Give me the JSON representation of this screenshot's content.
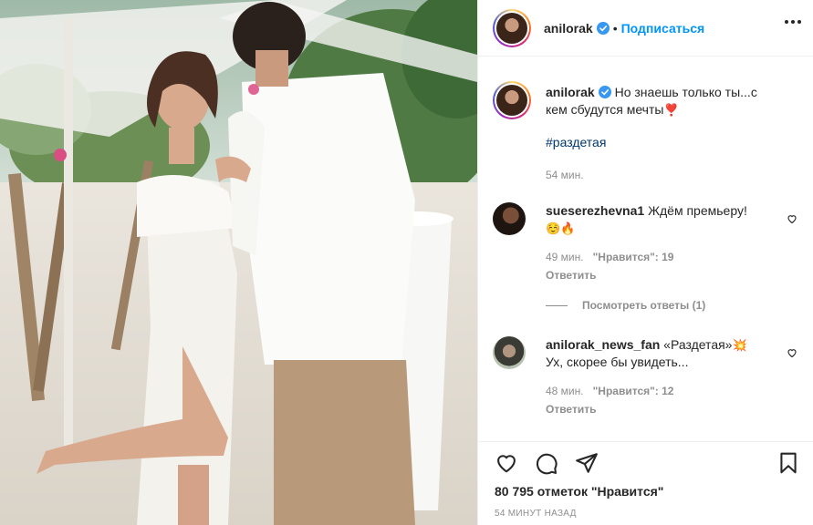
{
  "post": {
    "username": "anilorak",
    "follow_label": "Подписаться",
    "caption_text": "Но знаешь только ты...с кем сбудутся мечты",
    "caption_emoji": "❣️",
    "hashtag": "#раздетая",
    "caption_time": "54 мин.",
    "likes": "80 795 отметок \"Нравится\"",
    "time_ago": "54 МИНУТ НАЗАД"
  },
  "comments": [
    {
      "username": "sueserezhevna1",
      "text": "Ждём премьеру!",
      "emoji": "☺️🔥",
      "time": "49 мин.",
      "likes": "\"Нравится\": 19",
      "reply_label": "Ответить"
    },
    {
      "username": "anilorak_news_fan",
      "text_before": "«Раздетая»",
      "emoji": "💥",
      "text_after": "Ух, скорее бы увидеть...",
      "time": "48 мин.",
      "likes": "\"Нравится\": 12",
      "reply_label": "Ответить"
    }
  ],
  "view_replies_label": "Посмотреть ответы (1)",
  "colors": {
    "accent": "#0095f6",
    "text": "#262626",
    "muted": "#8e8e8e",
    "hashtag": "#00376b"
  },
  "icons": [
    "more-options-icon",
    "verified-badge-icon",
    "heart-icon",
    "comment-icon",
    "share-icon",
    "bookmark-icon",
    "like-comment-icon"
  ]
}
